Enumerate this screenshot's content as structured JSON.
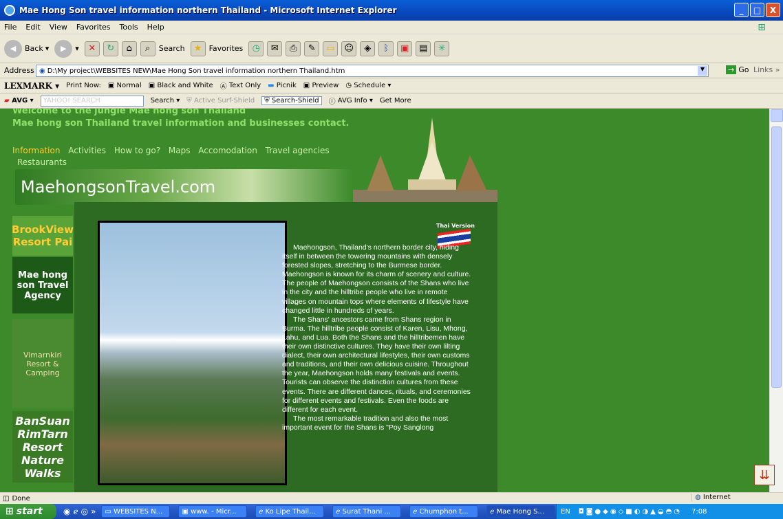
{
  "window": {
    "title": "Mae Hong Son travel information northern Thailand - Microsoft Internet Explorer",
    "min": "_",
    "max": "□",
    "close": "X"
  },
  "menu": [
    "File",
    "Edit",
    "View",
    "Favorites",
    "Tools",
    "Help"
  ],
  "toolbar": {
    "back": "Back",
    "search": "Search",
    "favorites": "Favorites"
  },
  "address": {
    "label": "Address",
    "value": "D:\\My project\\WEBSITES NEW\\Mae Hong Son travel information northern Thailand.htm",
    "go": "Go",
    "links": "Links"
  },
  "lexmark": {
    "brand": "LEXMARK",
    "print_now": "Print Now:",
    "normal": "Normal",
    "black_white": "Black and White",
    "text_only": "Text Only",
    "picnik": "Picnik",
    "preview": "Preview",
    "schedule": "Schedule"
  },
  "avg": {
    "brand": "AVG",
    "yahoo": "YAHOO! SEARCH",
    "search": "Search",
    "active_surf": "Active Surf-Shield",
    "search_shield": "Search-Shield",
    "avg_info": "AVG Info",
    "get_more": "Get More"
  },
  "page": {
    "title": "Welcome to the jungle Mae hong son Thailand",
    "subtitle": "Mae hong son Thailand travel information and businesses contact.",
    "nav": [
      "Information",
      "Activities",
      "How to go?",
      "Maps",
      "Accomodation",
      "Travel agencies"
    ],
    "nav2": "Restaurants",
    "logo": "MaehongsonTravel.com",
    "ads": [
      "BrookView Resort Pai",
      "Mae hong son Travel Agency",
      "Vimarnkiri Resort & Camping",
      "BanSuan RimTarn Resort Nature Walks"
    ],
    "thai_version": "Thai Version",
    "article": [
      "Maehongson, Thailand's northern border city, hiding itself in between the towering mountains with densely forested slopes, stretching to the Burmese border. Maehongson is known for its charm of scenery and culture. The people of Maehongson consists of the Shans who live in the city and the hilltribe people who live in remote villages on mountain tops where elements of lifestyle have changed little in hundreds of years.",
      "The Shans' ancestors came from Shans region in Burma. The hilltribe people consist of Karen, Lisu, Mhong, Lahu, and Lua. Both the Shans and the hilltribemen have their own distinctive cultures. They have their own lilting dialect, their own architectural lifestyles, their own customs and traditions, and their own delicious cuisine. Throughout the year, Maehongson holds many festivals and events. Tourists can observe the distinction cultures from these events. There are different dances, rituals, and ceremonies for different events and festivals. Even the foods are different for each event.",
      "The most remarkable tradition and also the most important event for the Shans is \"Poy Sanglong"
    ]
  },
  "status": {
    "text": "Done",
    "zone": "Internet"
  },
  "taskbar": {
    "start": "start",
    "tasks": [
      "WEBSITES N...",
      "www. - Micr...",
      "Ko Lipe Thail...",
      "Surat Thani ...",
      "Chumphon t...",
      "Mae Hong S..."
    ],
    "lang": "EN",
    "clock": "7:08"
  }
}
